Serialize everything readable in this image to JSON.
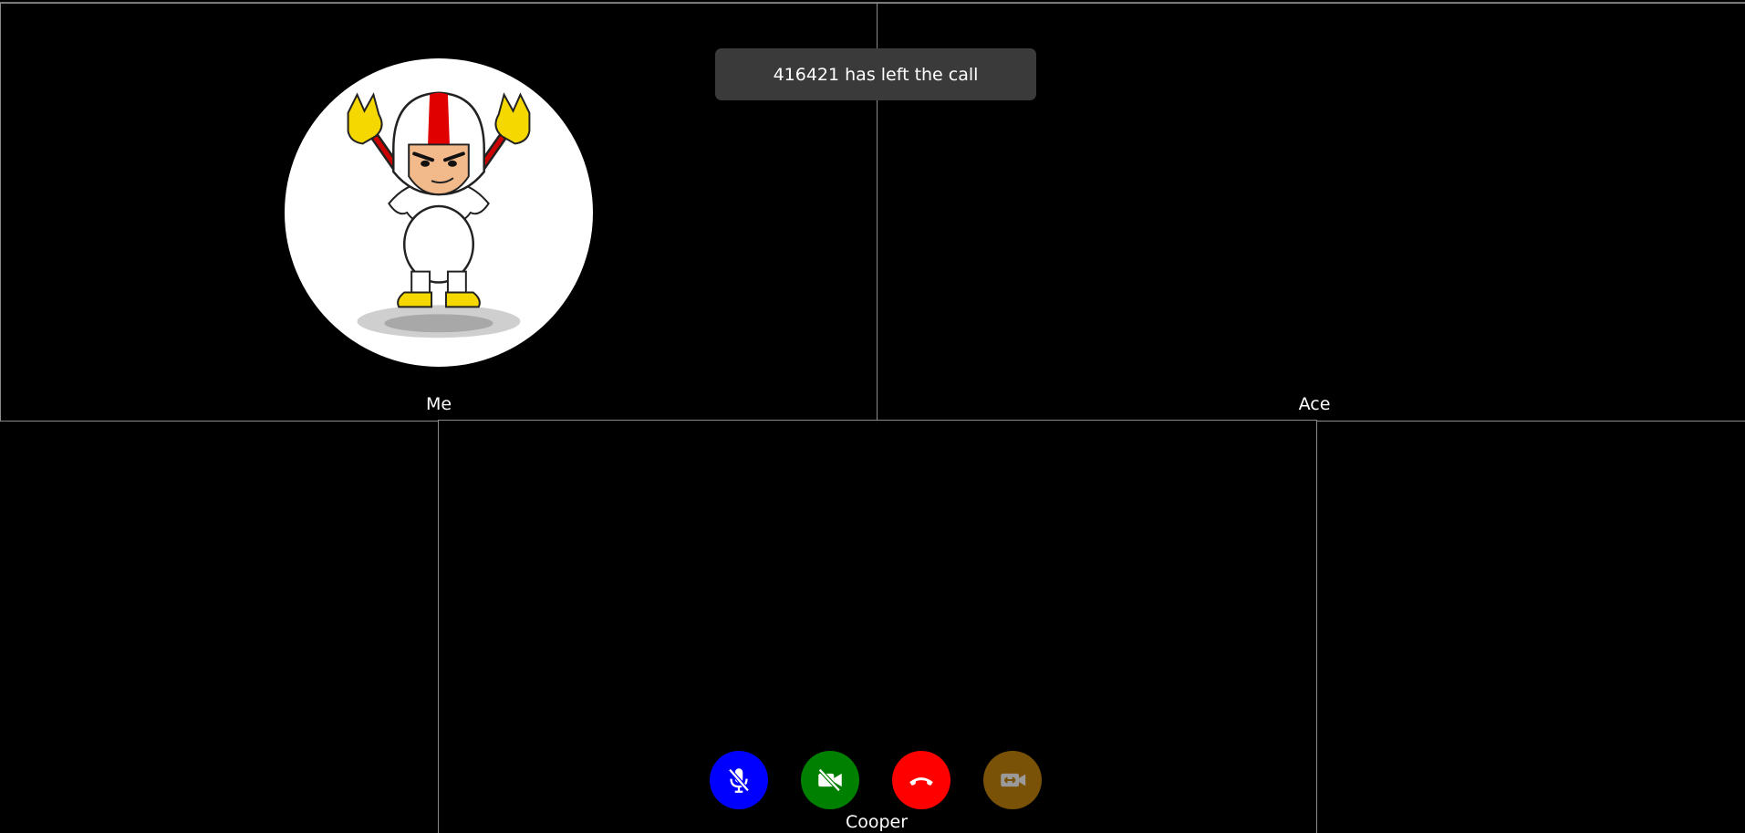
{
  "notification": {
    "text": "416421 has left the call"
  },
  "participants": {
    "me": {
      "name": "Me",
      "avatar_icon": "kid-daredevil-avatar"
    },
    "ace": {
      "name": "Ace"
    },
    "cooper": {
      "name": "Cooper"
    }
  },
  "controls": {
    "mic": {
      "icon": "mic-off-icon",
      "color": "#0000ff"
    },
    "video": {
      "icon": "video-off-icon",
      "color": "#008000"
    },
    "hangup": {
      "icon": "phone-hangup-icon",
      "color": "#ff0000"
    },
    "switch_camera": {
      "icon": "switch-camera-icon",
      "color": "#7a5207"
    }
  },
  "colors": {
    "background": "#000000",
    "tile_border": "#8a8a8a",
    "toast_bg": "#3a3a3a"
  }
}
